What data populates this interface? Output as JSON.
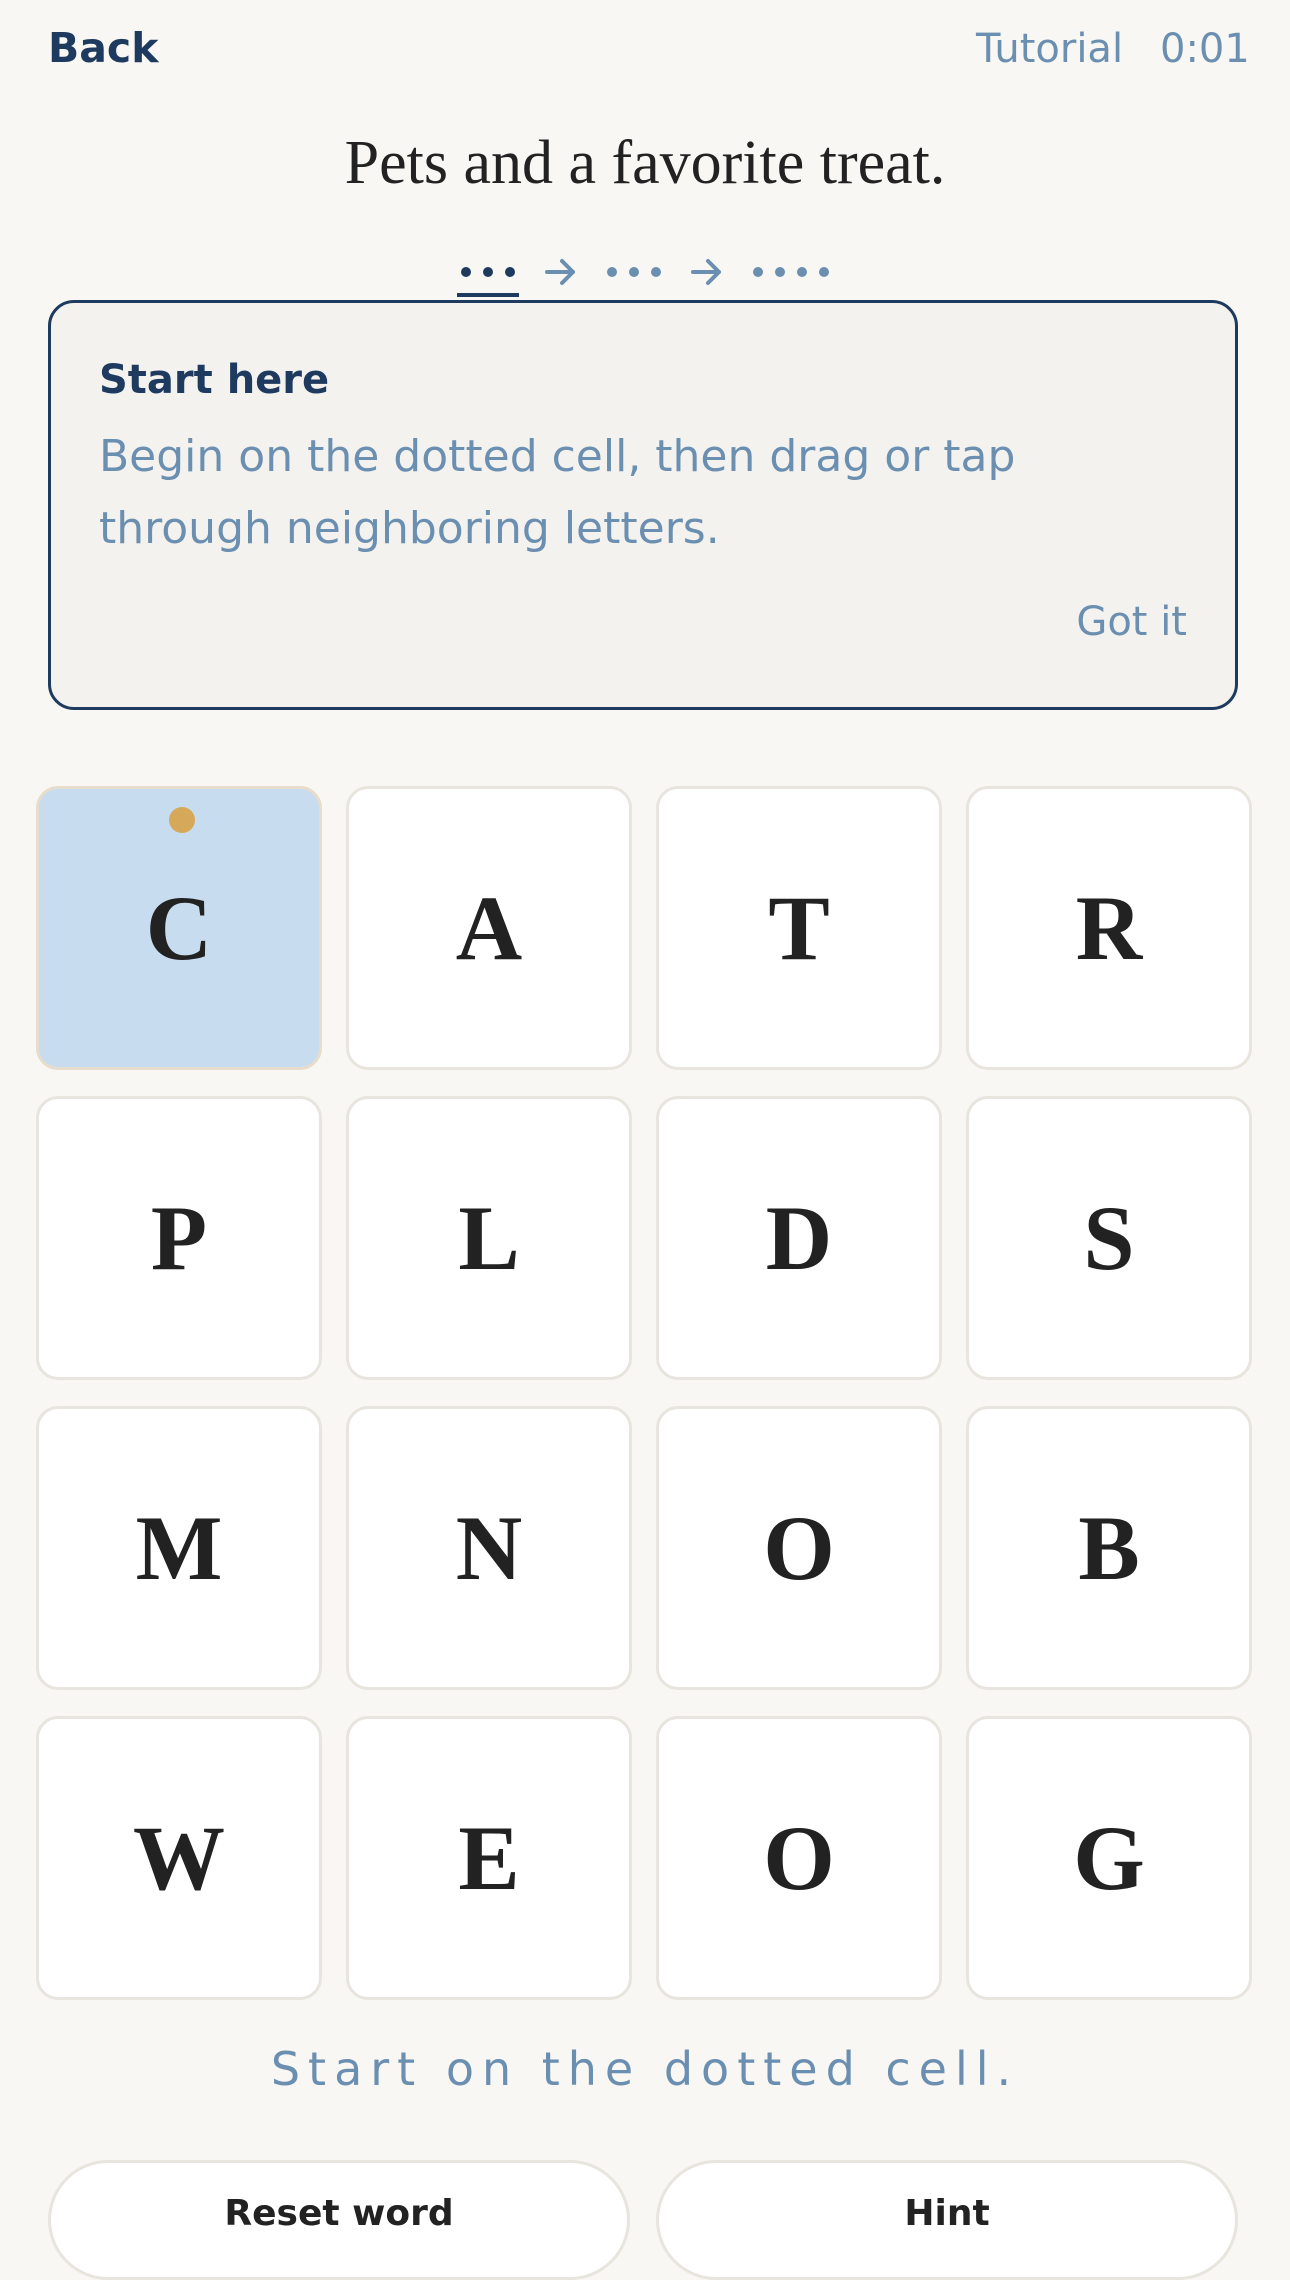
{
  "header": {
    "back_label": "Back",
    "tutorial_label": "Tutorial",
    "timer": "0:01"
  },
  "puzzle": {
    "clue": "Pets and a favorite treat.",
    "word_pattern": [
      3,
      3,
      4
    ],
    "active_word_index": 0
  },
  "tip": {
    "title": "Start here",
    "body": "Begin on the dotted cell, then drag or tap through neighboring letters.",
    "dismiss_label": "Got it"
  },
  "grid": {
    "rows": [
      [
        "C",
        "A",
        "T",
        "R"
      ],
      [
        "P",
        "L",
        "D",
        "S"
      ],
      [
        "M",
        "N",
        "O",
        "B"
      ],
      [
        "W",
        "E",
        "O",
        "G"
      ]
    ],
    "start_cell": [
      0,
      0
    ]
  },
  "status": "Start on the dotted cell.",
  "actions": {
    "reset_label": "Reset word",
    "hint_label": "Hint"
  },
  "colors": {
    "navy": "#1e3a5f",
    "muted_blue": "#6b8fb0",
    "start_cell_fill": "#c8dcef",
    "start_marker": "#d6a95a",
    "background": "#f8f7f3"
  }
}
